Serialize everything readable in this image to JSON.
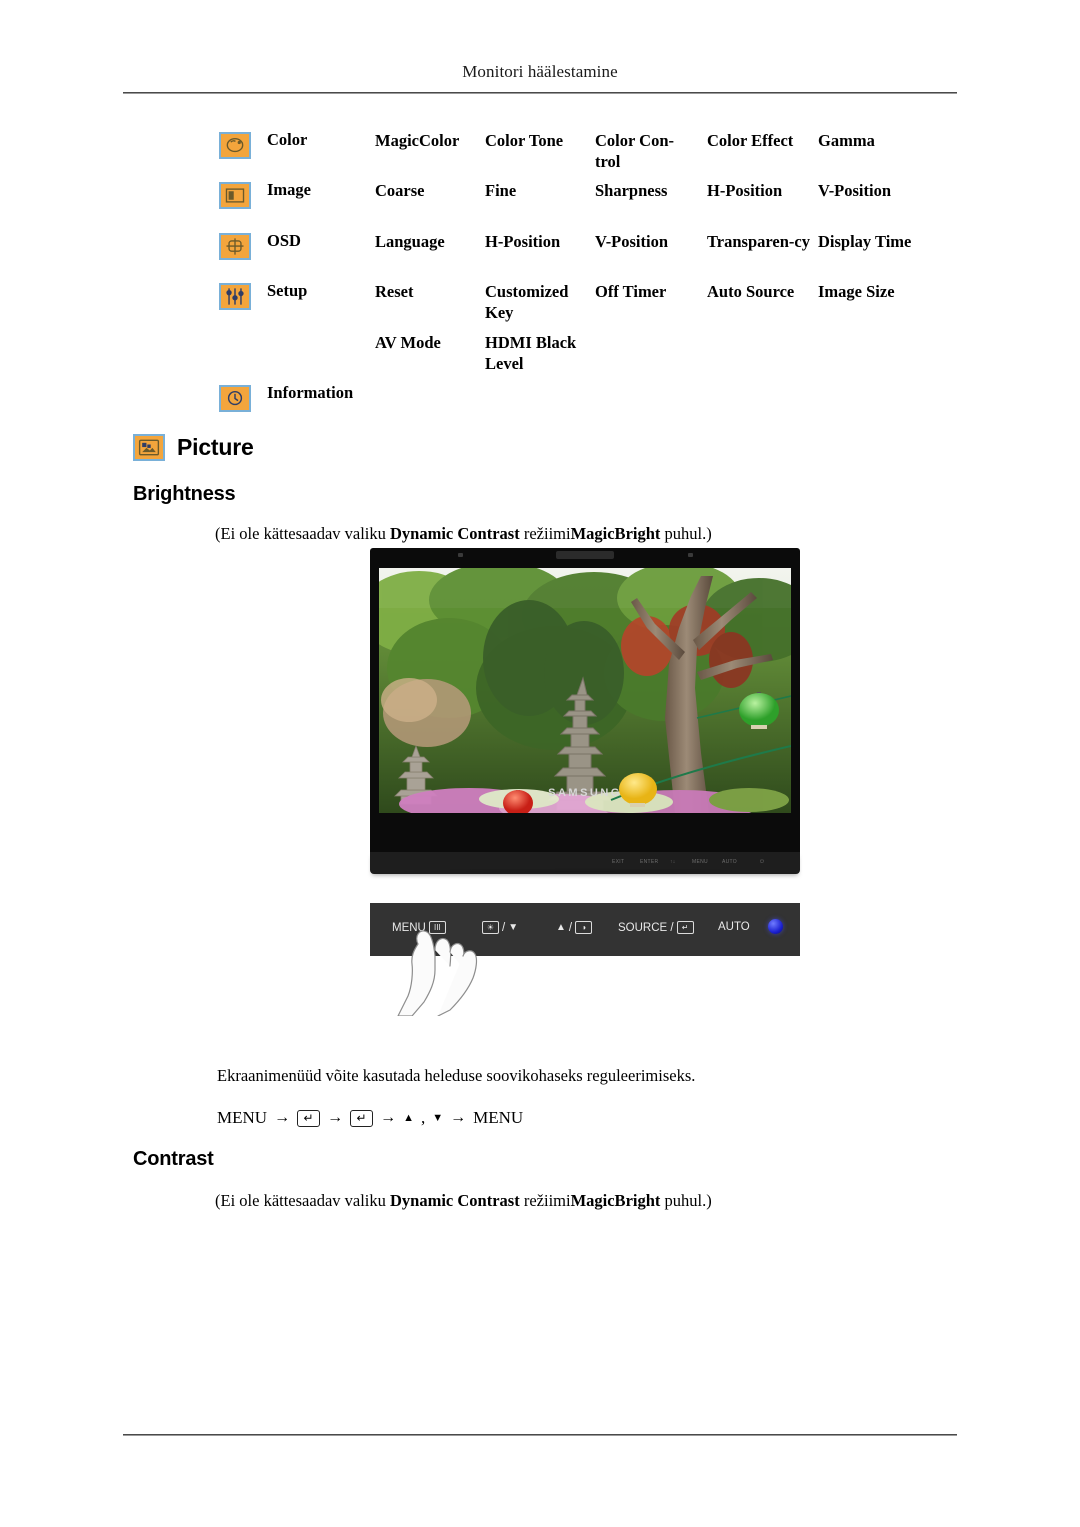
{
  "header": {
    "running_title": "Monitori häälestamine"
  },
  "menu_map": {
    "rows": [
      {
        "icon": "color-palette-icon",
        "label": "Color",
        "cells": [
          "MagicColor",
          "Color Tone",
          "Color Con-trol",
          "Color Effect",
          "Gamma"
        ]
      },
      {
        "icon": "image-frame-icon",
        "label": "Image",
        "cells": [
          "Coarse",
          "Fine",
          "Sharpness",
          "H-Position",
          "V-Position"
        ]
      },
      {
        "icon": "osd-box-icon",
        "label": "OSD",
        "cells": [
          "Language",
          "H-Position",
          "V-Position",
          "Transparen-cy",
          "Display Time"
        ]
      },
      {
        "icon": "setup-sliders-icon",
        "label": "Setup",
        "cells": [
          "Reset",
          "Customized Key",
          "Off Timer",
          "Auto Source",
          "Image Size"
        ]
      },
      {
        "icon": "",
        "label": "",
        "cells": [
          "AV Mode",
          "HDMI  Black Level",
          "",
          "",
          ""
        ]
      },
      {
        "icon": "information-clock-icon",
        "label": "Information",
        "cells": [
          "",
          "",
          "",
          "",
          ""
        ]
      }
    ]
  },
  "sections": {
    "picture_heading": "Picture",
    "brightness_heading": "Brightness",
    "contrast_heading": "Contrast",
    "note_prefix": "(Ei ole kättesaadav valiku ",
    "note_bold1": "Dynamic Contrast",
    "note_middle": " režiimi",
    "note_bold2": "MagicBright",
    "note_suffix": " puhul.)",
    "brightness_body": "Ekraanimenüüd võite kasutada heleduse soovikohaseks reguleerimiseks."
  },
  "key_sequence": {
    "menu_label": "MENU",
    "arrow": "→",
    "enter_key": "↵",
    "up_triangle": "▲",
    "comma": ",",
    "down_triangle": "▼",
    "menu_end_label": "MENU"
  },
  "monitor": {
    "brand": "SAMSUNG",
    "base_labels": [
      "EXIT",
      "ENTER",
      "↑↓",
      "MENU",
      "AUTO",
      "⏻"
    ]
  },
  "control_panel": {
    "menu_button": "MENU",
    "menu_box": "III",
    "brightness_box": "☀",
    "brightness_tri": "▼",
    "volume_tri": "▲",
    "volume_box": "◑",
    "source_label": "SOURCE /",
    "source_box": "↵",
    "auto_label": "AUTO",
    "power_icon": "power-button-icon"
  },
  "colors": {
    "icon_fill": "#f3a53c",
    "icon_border": "#79b0d8",
    "panel_bg": "#333333",
    "bezel": "#0b0b0b",
    "power_blue": "#1a1fd0"
  }
}
